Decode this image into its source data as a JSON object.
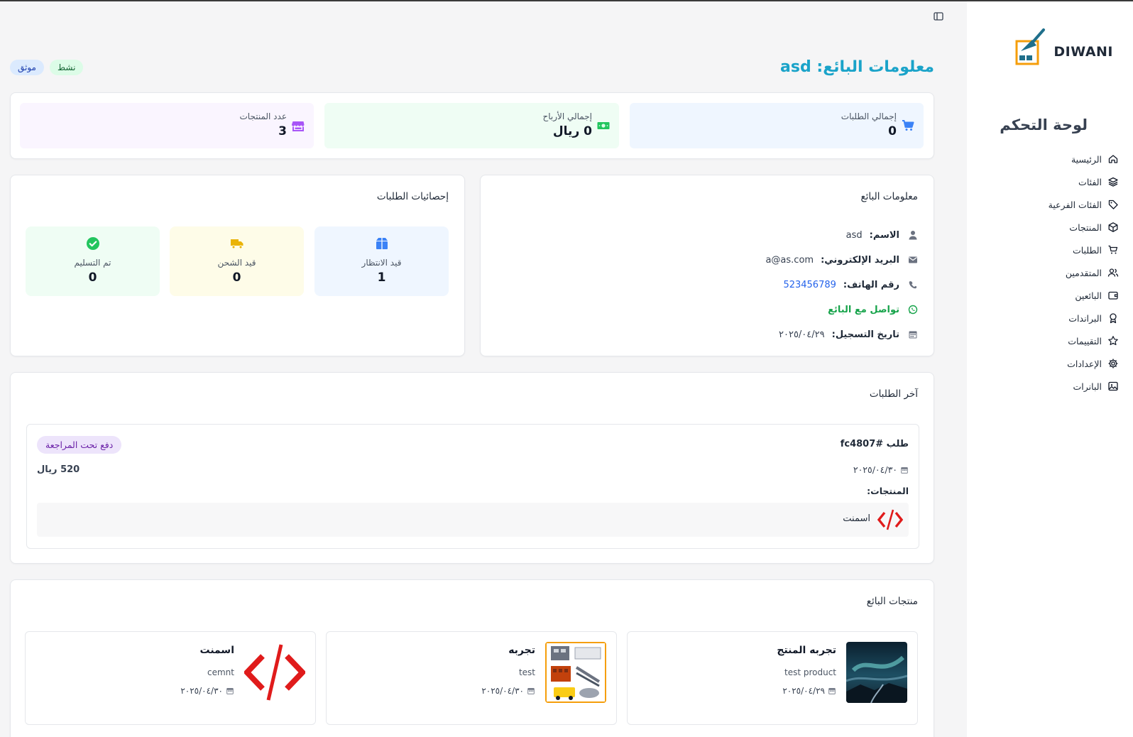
{
  "colors": {
    "accent": "#1aa3c9",
    "blue_soft": "#eff6ff",
    "green_soft": "#effdf4",
    "purple_soft": "#faf5ff",
    "yellow_soft": "#fefce8",
    "link": "#2563eb",
    "whatsapp": "#16a34a"
  },
  "logo": {
    "text": "DIWANI"
  },
  "sidebar": {
    "title": "لوحة التحكم",
    "items": [
      {
        "label": "الرئيسية",
        "icon": "home-icon"
      },
      {
        "label": "الفئات",
        "icon": "layers-icon"
      },
      {
        "label": "الفئات الفرعية",
        "icon": "tag-icon"
      },
      {
        "label": "المنتجات",
        "icon": "box-icon"
      },
      {
        "label": "الطلبات",
        "icon": "cart-icon"
      },
      {
        "label": "المتقدمين",
        "icon": "users-icon"
      },
      {
        "label": "البائعين",
        "icon": "wallet-icon"
      },
      {
        "label": "البراندات",
        "icon": "award-icon"
      },
      {
        "label": "التقييمات",
        "icon": "star-icon"
      },
      {
        "label": "الإعدادات",
        "icon": "gear-icon"
      },
      {
        "label": "البانرات",
        "icon": "image-icon"
      }
    ]
  },
  "header": {
    "title": "معلومات البائع: asd",
    "badges": {
      "active": "نشط",
      "verified": "موثق"
    }
  },
  "stats": {
    "orders": {
      "label": "إجمالي الطلبات",
      "value": "0"
    },
    "profit": {
      "label": "إجمالي الأرباح",
      "value": "0 ريال"
    },
    "products": {
      "label": "عدد المنتجات",
      "value": "3"
    }
  },
  "seller_info": {
    "title": "معلومات البائع",
    "name_label": "الاسم:",
    "name_value": "asd",
    "email_label": "البريد الإلكتروني:",
    "email_value": "a@as.com",
    "phone_label": "رقم الهاتف:",
    "phone_value": "523456789",
    "whatsapp_label": "تواصل مع البائع",
    "date_label": "تاريخ التسجيل:",
    "date_value": "٢٠٢٥/٠٤/٢٩"
  },
  "order_stats": {
    "title": "إحصائيات الطلبات",
    "pending": {
      "label": "قيد الانتظار",
      "value": "1"
    },
    "shipping": {
      "label": "قيد الشحن",
      "value": "0"
    },
    "delivered": {
      "label": "تم التسليم",
      "value": "0"
    }
  },
  "latest_orders": {
    "title": "آخر الطلبات",
    "order": {
      "id": "طلب #fc4807",
      "status": "دفع تحت المراجعة",
      "date": "٢٠٢٥/٠٤/٣٠",
      "total": "520 ريال",
      "products_label": "المنتجات:",
      "product_name": "اسمنت"
    }
  },
  "seller_products": {
    "title": "منتجات البائع",
    "items": [
      {
        "name": "تجربه المنتج",
        "desc": "test product",
        "date": "٢٠٢٥/٠٤/٢٩"
      },
      {
        "name": "تجربه",
        "desc": "test",
        "date": "٢٠٢٥/٠٤/٣٠"
      },
      {
        "name": "اسمنت",
        "desc": "cemnt",
        "date": "٢٠٢٥/٠٤/٣٠"
      }
    ]
  }
}
